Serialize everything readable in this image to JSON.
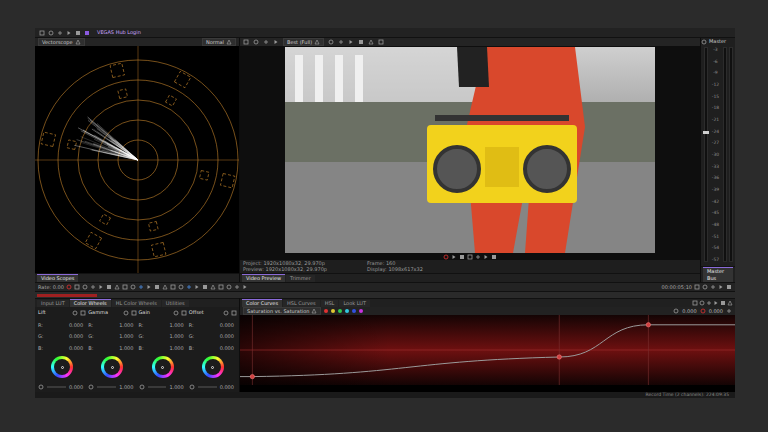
{
  "app": {
    "hub_label": "VEGAS Hub Login"
  },
  "scopes": {
    "scope": "Vectorscope",
    "mode": "Normal",
    "tab": "Video Scopes"
  },
  "preview": {
    "quality": "Best (Full)",
    "info_left": [
      "Project: 1920x1080x32, 29.970p",
      "Preview: 1920x1080x32, 29.970p"
    ],
    "info_right": [
      "Frame: 160",
      "Display: 1098x617x32"
    ],
    "tabs": [
      {
        "label": "Video Preview",
        "selected": true
      },
      {
        "label": "Trimmer",
        "selected": false
      }
    ]
  },
  "meter": {
    "title": "Master",
    "scale": [
      "-3",
      "-6",
      "-9",
      "-12",
      "-15",
      "-18",
      "-21",
      "-24",
      "-27",
      "-30",
      "-33",
      "-36",
      "-39",
      "-42",
      "-45",
      "-48",
      "-51",
      "-54",
      "-57"
    ],
    "channels": [
      {
        "level": 0
      },
      {
        "level": 0
      }
    ],
    "fader": {
      "level": 0.6
    },
    "tab": "Master Bus"
  },
  "transport": {
    "rate": "Rate: 0.00",
    "time": "00:00:05;10"
  },
  "grading": {
    "tabs": [
      {
        "label": "Input LUT",
        "selected": false
      },
      {
        "label": "Color Wheels",
        "selected": true
      },
      {
        "label": "HL Color Wheels",
        "selected": false
      },
      {
        "label": "Utilities",
        "selected": false
      }
    ],
    "wheels": [
      {
        "name": "Lift",
        "rows": [
          {
            "label": "R:",
            "value": "0.000"
          },
          {
            "label": "G:",
            "value": "0.000"
          },
          {
            "label": "B:",
            "value": "0.000"
          }
        ],
        "value": "0.000"
      },
      {
        "name": "Gamma",
        "rows": [
          {
            "label": "R:",
            "value": "1.000"
          },
          {
            "label": "G:",
            "value": "1.000"
          },
          {
            "label": "B:",
            "value": "1.000"
          }
        ],
        "value": "1.000"
      },
      {
        "name": "Gain",
        "rows": [
          {
            "label": "R:",
            "value": "1.000"
          },
          {
            "label": "G:",
            "value": "1.000"
          },
          {
            "label": "B:",
            "value": "1.000"
          }
        ],
        "value": "1.000"
      },
      {
        "name": "Offset",
        "rows": [
          {
            "label": "R:",
            "value": "0.000"
          },
          {
            "label": "G:",
            "value": "0.000"
          },
          {
            "label": "B:",
            "value": "0.000"
          }
        ],
        "value": "0.000"
      }
    ]
  },
  "curves": {
    "tabs": [
      {
        "label": "Color Curves",
        "selected": true
      },
      {
        "label": "HSL Curves",
        "selected": false
      },
      {
        "label": "HSL",
        "selected": false
      },
      {
        "label": "Look LUT",
        "selected": false
      }
    ],
    "mode": "Saturation vs. Saturation",
    "hue_presets": [
      {
        "color": "#e03232"
      },
      {
        "color": "#e0c832"
      },
      {
        "color": "#32c850"
      },
      {
        "color": "#32c8e0"
      },
      {
        "color": "#3250e0"
      },
      {
        "color": "#c832e0"
      }
    ],
    "input_value": "0.000",
    "output_value": "0.000",
    "points": [
      {
        "x": 0.025,
        "y": 0.12
      },
      {
        "x": 0.645,
        "y": 0.4
      },
      {
        "x": 0.825,
        "y": 0.86
      }
    ]
  },
  "status": "Record Time (2 channels): 224:09:35"
}
